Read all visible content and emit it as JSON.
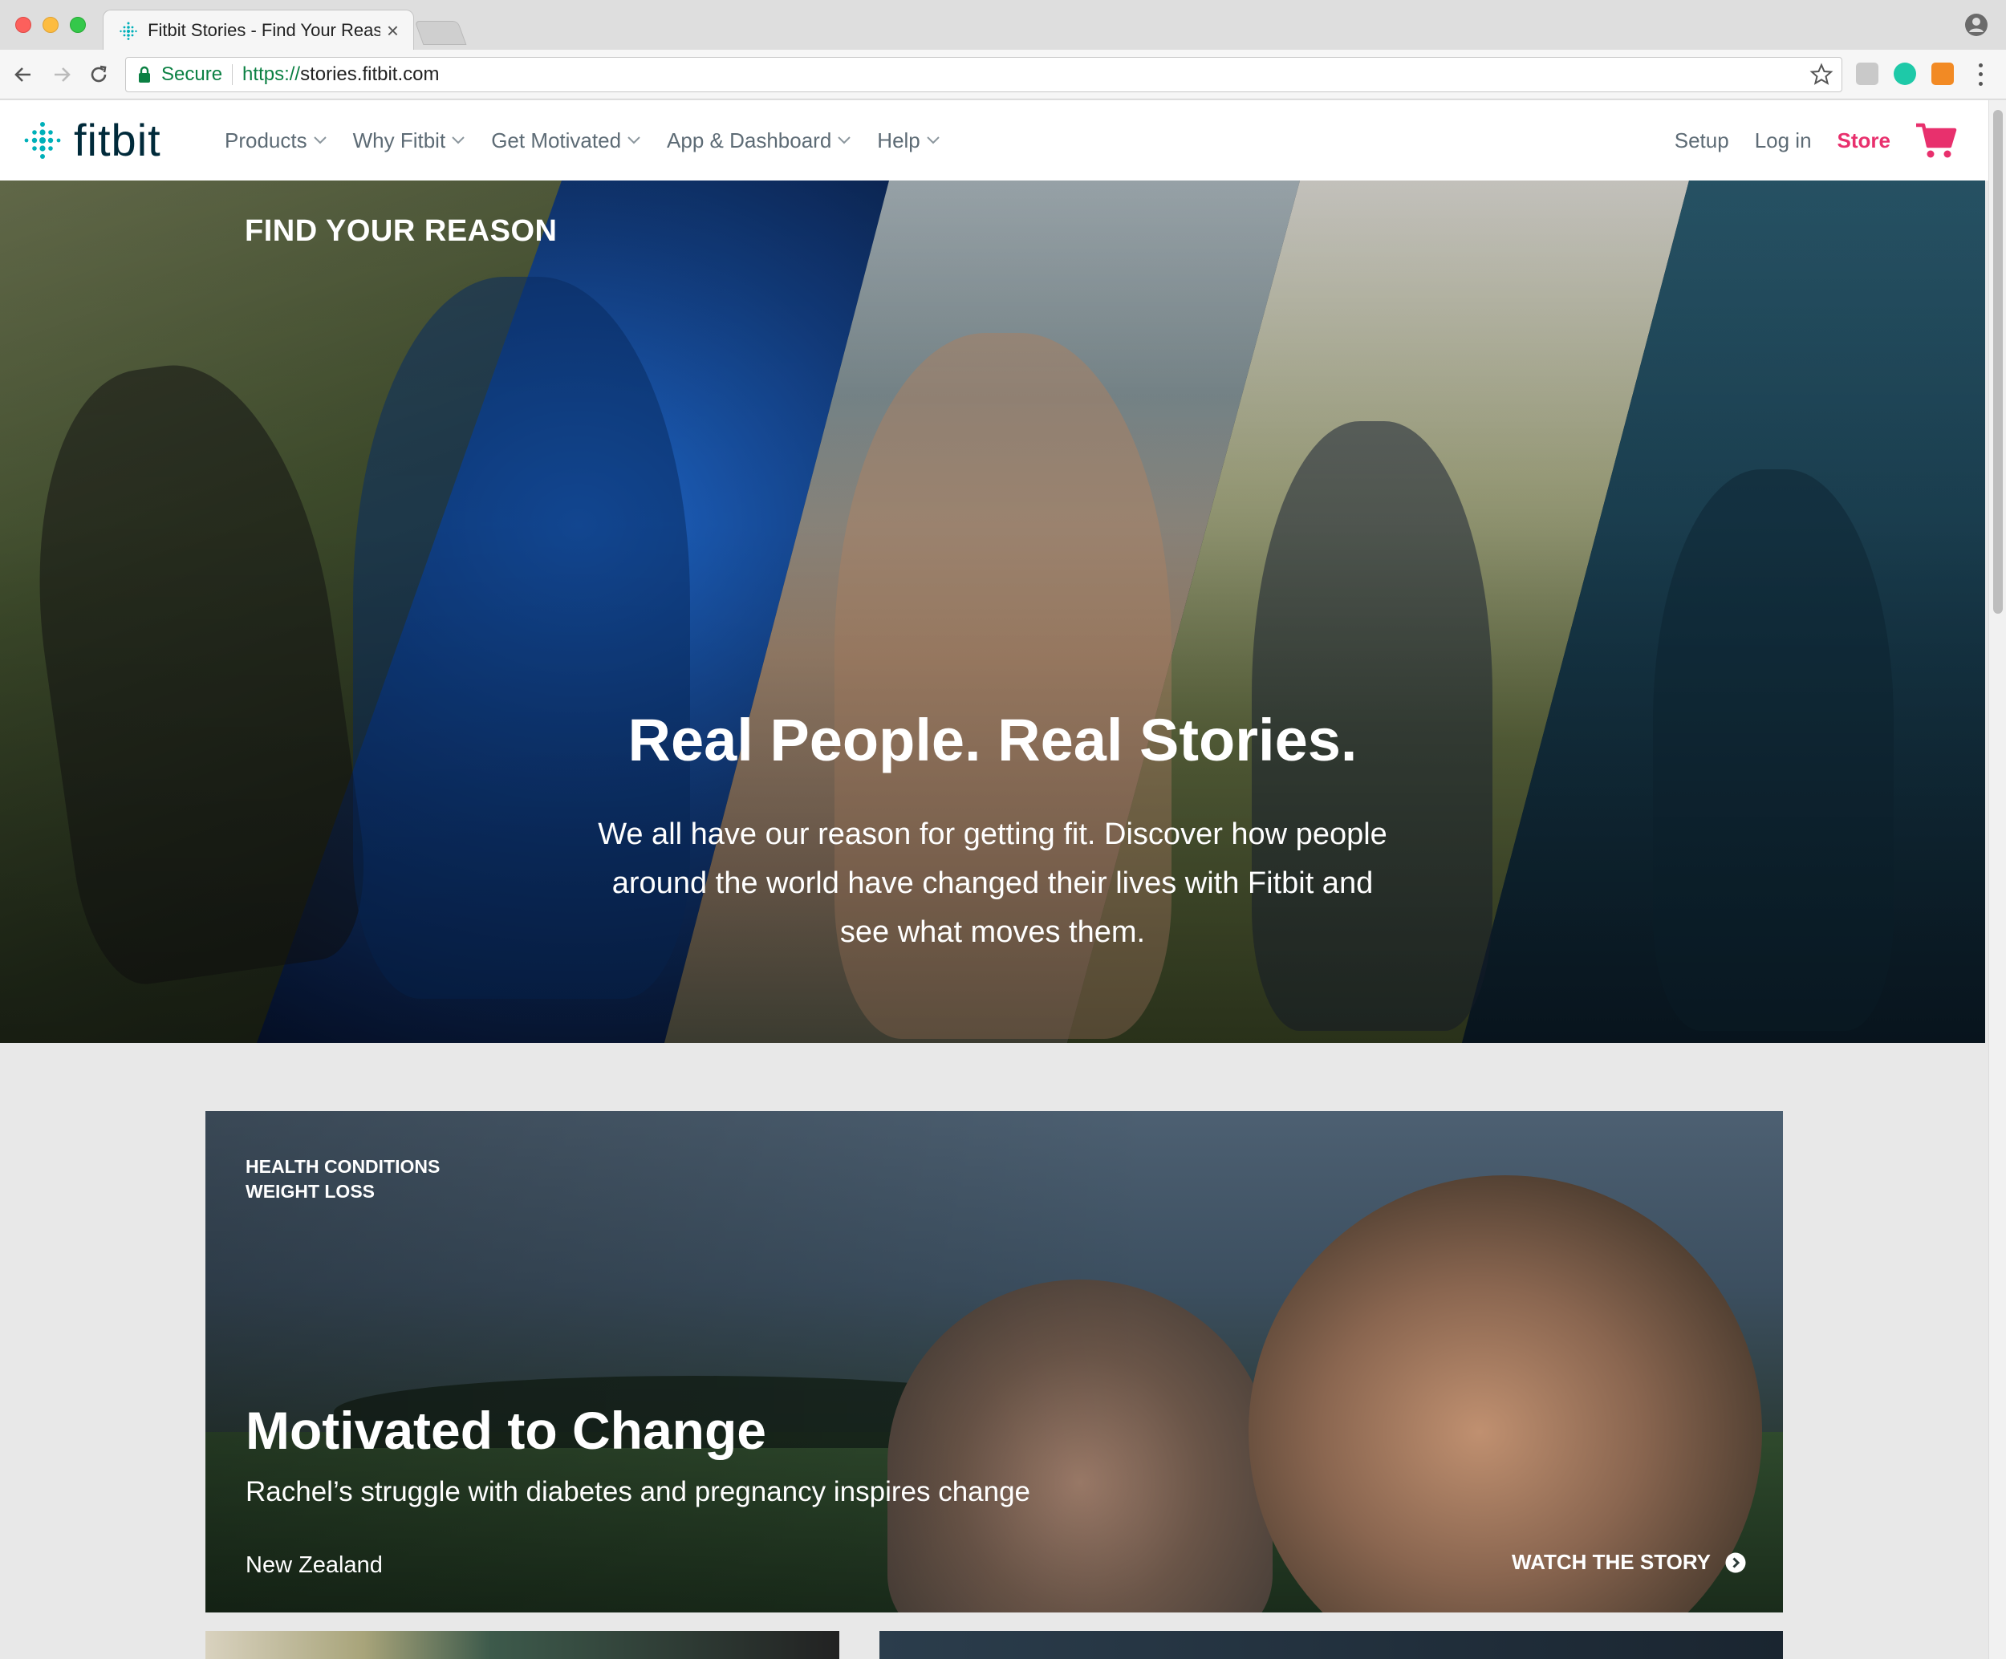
{
  "browser": {
    "tab_title": "Fitbit Stories - Find Your Reas",
    "secure_label": "Secure",
    "url_scheme": "https://",
    "url_host": "stories.fitbit.com"
  },
  "site": {
    "logo_text": "fitbit",
    "nav": [
      {
        "label": "Products"
      },
      {
        "label": "Why Fitbit"
      },
      {
        "label": "Get Motivated"
      },
      {
        "label": "App & Dashboard"
      },
      {
        "label": "Help"
      }
    ],
    "setup": "Setup",
    "login": "Log in",
    "store": "Store"
  },
  "hero": {
    "eyebrow": "FIND YOUR REASON",
    "title": "Real People. Real Stories.",
    "copy_line1": "We all have our reason for getting fit. Discover how people",
    "copy_line2": "around the world have changed their lives with Fitbit and",
    "copy_line3": "see what moves them."
  },
  "story": {
    "tags": [
      "HEALTH CONDITIONS",
      "WEIGHT LOSS"
    ],
    "title": "Motivated to Change",
    "subtitle": "Rachel’s struggle with diabetes and pregnancy inspires change",
    "location": "New Zealand",
    "cta": "WATCH THE STORY"
  },
  "colors": {
    "brand_teal": "#00b0b9",
    "brand_navy": "#002a3a",
    "store_pink": "#e8306d",
    "secure_green": "#0b8043"
  }
}
